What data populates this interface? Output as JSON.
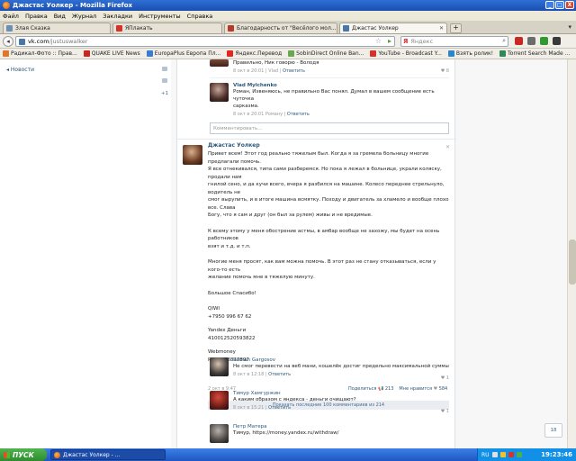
{
  "window": {
    "title": "Джастас Уолкер - Mozilla Firefox",
    "controls": [
      "_",
      "□",
      "X"
    ]
  },
  "menu": [
    "Файл",
    "Правка",
    "Вид",
    "Журнал",
    "Закладки",
    "Инструменты",
    "Справка"
  ],
  "tabs": [
    {
      "label": "Злая Сказка",
      "color": "#6d8fb3"
    },
    {
      "label": "ЯПлакать",
      "color": "#d6312a"
    },
    {
      "label": "Благодарность от \"Весёлого мол...",
      "color": "#b53a2a"
    },
    {
      "label": "Джастас Уолкер",
      "color": "#4a76a8",
      "active": true
    }
  ],
  "newtab_label": "+",
  "url": {
    "domain": "vk.com",
    "path": "/justuswalker"
  },
  "search": {
    "engine": "Я",
    "placeholder": "Яндекс"
  },
  "bookmarks": [
    {
      "label": "Радикал-Фото :: Прав...",
      "color": "#e2762b"
    },
    {
      "label": "QUAKE LIVE News",
      "color": "#c9271f"
    },
    {
      "label": "EuropaPlus Европа Пл...",
      "color": "#3a7cd0"
    },
    {
      "label": "Яндекс.Перевод",
      "color": "#e52620"
    },
    {
      "label": "SobinDirect Online Ban...",
      "color": "#6aa84f"
    },
    {
      "label": "YouTube - Broadcast Y...",
      "color": "#d6312a"
    },
    {
      "label": "Взять ролик!",
      "color": "#2b87c9"
    },
    {
      "label": "Torrent Search Made ...",
      "color": "#2e8b57"
    }
  ],
  "leftnav": {
    "news": "◂ Новости",
    "plus1": "+1"
  },
  "comments_top": [
    {
      "text": "Правильно, Ник говорю - Володя",
      "meta_date": "8 окт в 20:01",
      "meta_author": "Vlad",
      "reply": "Ответить",
      "likes": "♥ 8"
    },
    {
      "author": "Vlad Mylchenko",
      "text_lines": [
        "Роман, Извеняюсь, не правильно Вас понял. Думал в вашем сообщение есть чуточка",
        "сарказма."
      ],
      "meta_date": "8 окт в 20:01",
      "meta_author": "Роману",
      "reply": "Ответить"
    }
  ],
  "comment_placeholder": "Комментировать...",
  "post": {
    "author": "Джастас Уолкер",
    "close": "✕",
    "para1": [
      "Привет всем! Этот год реально тяжелым был. Когда я за гремела больницу многие предлагали помочь.",
      "Я все отнекивался, типа сами разберемся. Но пока я лежал в больнице, украли коляску, продали нам",
      "гнилой сено, и да кучи всего, вчера я разбился на машине. Колесо переднее стрельнуло, водитель не",
      "смог вырулить, и в итоге машина всмятку. Походу и двигатель за хламело и вообще плохо все. Слава",
      "Богу, что я сам и друг (он был за рулем) живы и не вредимые."
    ],
    "para2": [
      "К всему этому у меня обострение астмы, в амбар вообще не захожу, мы будет на осень работников",
      "взят и т.д. и т.п."
    ],
    "para3": [
      "Многие меня просят, как вам можна помочь. В этот раз не стану отказываться, если у кого-то есть",
      "желание помочь мне в тяжелую минуту."
    ],
    "thanks": "Большое Спасибо!",
    "qiwi_label": "QIWI",
    "qiwi_number": "+7950 996 67 62",
    "yandex_label": "Yandex Деньги",
    "yandex_number": "410012520593822",
    "webmoney_label": "Webmoney",
    "webmoney_number": "R706168837897",
    "date": "2 окт в 9:47",
    "share": "Поделиться",
    "share_count": "213",
    "like": "Мне нравится",
    "like_count": "584",
    "show_all": "Показать последние 100 комментариев из 214"
  },
  "comments_bottom": [
    {
      "author": "Roman Gargosov",
      "text": "Не смог перевести на веб мани, кошелёк достиг предельно максимальной суммы",
      "meta_date": "8 окт в 12:18",
      "reply": "Ответить",
      "likes": "♥ 1"
    },
    {
      "author": "Тимур Хамгуржин",
      "text": "А каким образом с яндекса - деньги очищают?",
      "meta_date": "8 окт в 15:21",
      "reply": "Ответить",
      "likes": "♥ 1"
    },
    {
      "author": "Петр Матера",
      "text": "Тимур, https://money.yandex.ru/withdraw/"
    }
  ],
  "chat_label": "18",
  "taskbar": {
    "start": "ПУСК",
    "item": "Джастас Уолкер - ...",
    "lang": "RU",
    "clock": "19:23:46"
  }
}
